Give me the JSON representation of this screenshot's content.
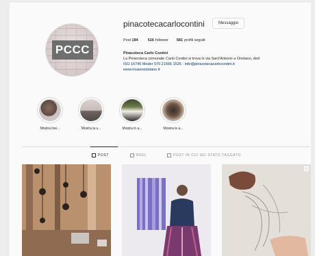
{
  "profile": {
    "username": "pinacotecacarlocontini",
    "message_button": "Messaggio",
    "avatar_text": "PCCC",
    "stats": [
      {
        "count": "184",
        "label": "Post"
      },
      {
        "count": "516",
        "label": "follower"
      },
      {
        "count": "581",
        "label": "profili seguiti"
      }
    ],
    "bio_name": "Pinacoteca Carlo Contini",
    "bio_line1": "La Pinacoteca comunale Carlo Contini si trova in via Sant'Antonio a Oristano, ded",
    "bio_line2": "ISO 16745 Moder 070 21566 1526 - info@pinacotecacarlocontini.it",
    "bio_link": "www.museooristano.it"
  },
  "highlights": [
    {
      "label": "Mostra line..."
    },
    {
      "label": "Mostra la s..."
    },
    {
      "label": "Mostra in a..."
    },
    {
      "label": "Mostra le a..."
    }
  ],
  "tabs": [
    {
      "label": "POST"
    },
    {
      "label": "REEL"
    },
    {
      "label": "POST IN CUI SEI STATO TAGGATO"
    }
  ],
  "colors": {
    "background": "#fafafa",
    "link": "#00376b",
    "divider": "#dbdbdb"
  },
  "icons": [
    "grid-icon",
    "reel-icon",
    "tagged-icon",
    "carousel-icon"
  ]
}
